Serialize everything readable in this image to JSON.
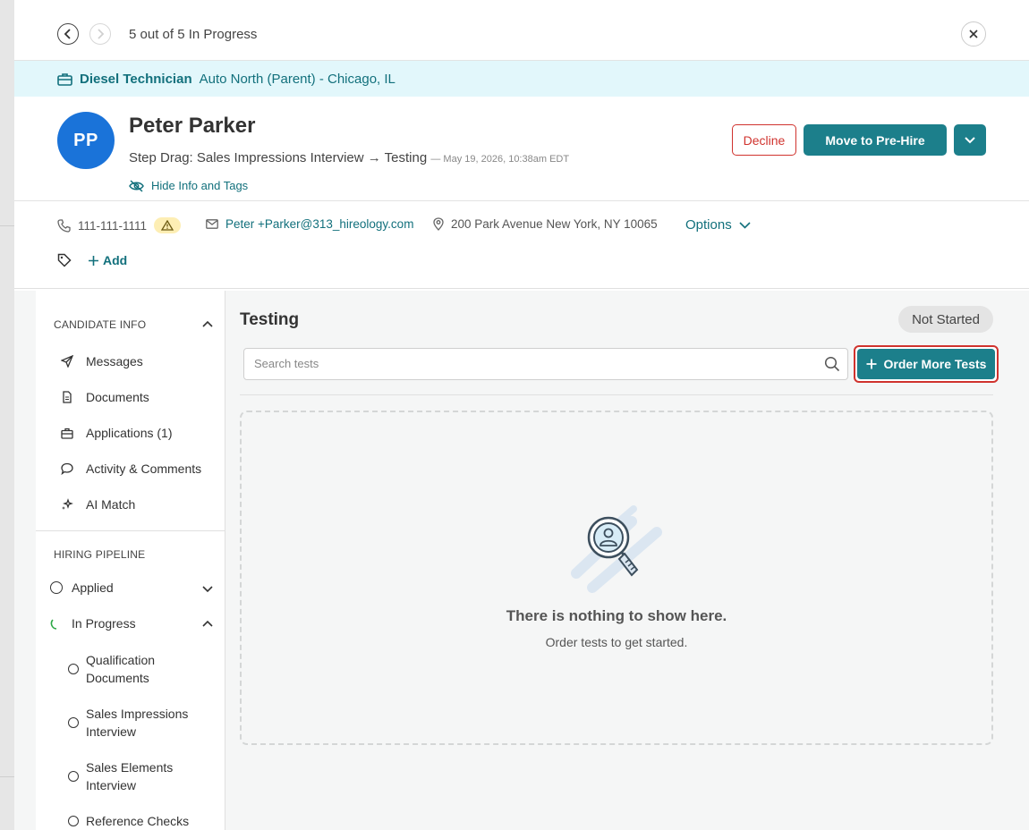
{
  "nav": {
    "counter": "5 out of 5 In Progress"
  },
  "job": {
    "title": "Diesel Technician",
    "location": "Auto North (Parent) - Chicago, IL"
  },
  "candidate": {
    "initials": "PP",
    "name": "Peter Parker",
    "step": "Step Drag: Sales Impressions Interview → Testing",
    "timestamp": "— May 19, 2026, 10:38am EDT",
    "hide_info_label": "Hide Info and Tags"
  },
  "actions": {
    "decline": "Decline",
    "move": "Move to Pre-Hire"
  },
  "contact": {
    "phone": "111-111-1111",
    "email": "Peter +Parker@313_hireology.com",
    "address": "200 Park Avenue New York, NY 10065",
    "options_label": "Options",
    "add_tag_label": "Add"
  },
  "sidebar": {
    "candidate_info_heading": "CANDIDATE INFO",
    "items": [
      {
        "label": "Messages",
        "icon": "send-icon"
      },
      {
        "label": "Documents",
        "icon": "document-icon"
      },
      {
        "label": "Applications (1)",
        "icon": "briefcase-icon"
      },
      {
        "label": "Activity & Comments",
        "icon": "comment-icon"
      },
      {
        "label": "AI Match",
        "icon": "sparkle-icon"
      }
    ],
    "pipeline_heading": "HIRING PIPELINE",
    "pipeline": [
      {
        "label": "Applied"
      },
      {
        "label": "In Progress"
      }
    ],
    "sub_stages": [
      {
        "line1": "Qualification",
        "line2": "Documents"
      },
      {
        "line1": "Sales Impressions",
        "line2": "Interview"
      },
      {
        "line1": "Sales Elements",
        "line2": "Interview"
      },
      {
        "line1": "Reference Checks",
        "line2": ""
      }
    ]
  },
  "main": {
    "title": "Testing",
    "status": "Not Started",
    "search_placeholder": "Search tests",
    "order_button": "Order More Tests",
    "empty_title": "There is nothing to show here.",
    "empty_subtitle": "Order tests to get started."
  },
  "colors": {
    "teal": "#1c7f8b",
    "link": "#12707c",
    "danger": "#d0332e",
    "avatar": "#1a73d9",
    "banner": "#e2f7fb"
  }
}
